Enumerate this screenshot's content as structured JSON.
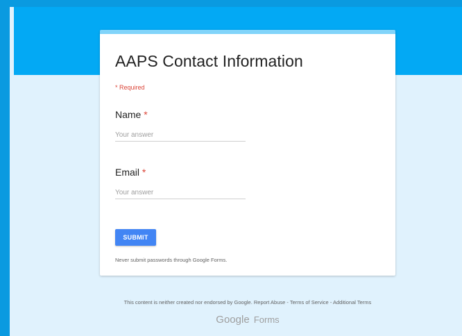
{
  "form": {
    "title": "AAPS Contact Information",
    "required_note": "* Required",
    "questions": [
      {
        "label": "Name",
        "required_mark": "*",
        "placeholder": "Your answer"
      },
      {
        "label": "Email",
        "required_mark": "*",
        "placeholder": "Your answer"
      }
    ],
    "submit_label": "SUBMIT",
    "password_note": "Never submit passwords through Google Forms."
  },
  "footer": {
    "disclaimer": "This content is neither created nor endorsed by Google.",
    "report_abuse": "Report Abuse",
    "separator": "-",
    "terms": "Terms of Service",
    "additional_terms": "Additional Terms",
    "logo_google": "Google",
    "logo_forms": "Forms"
  },
  "colors": {
    "outer_frame": "#0a9ae0",
    "header_band": "#03a9f4",
    "page_background": "#e0f2fd",
    "card_accent": "#81d4fa",
    "submit_button": "#4285f4",
    "required_red": "#db4437"
  }
}
